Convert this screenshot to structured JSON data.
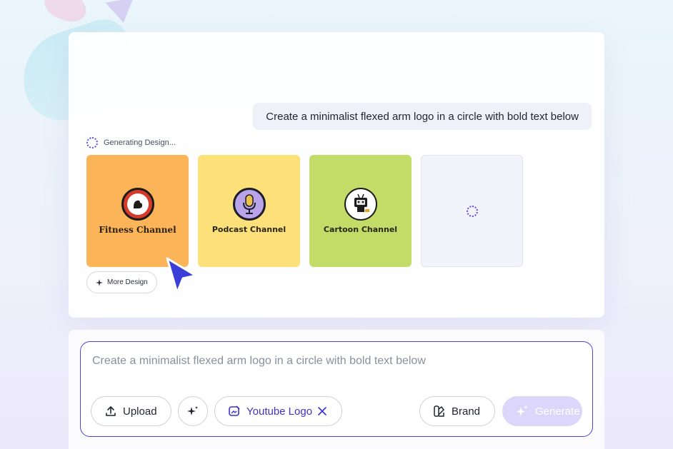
{
  "chat": {
    "prompt_text": "Create a minimalist flexed arm logo in a circle with bold text below",
    "status_text": "Generating Design...",
    "cards": [
      {
        "title": "Fitness Channel",
        "icon": "flexed-arm-icon"
      },
      {
        "title": "Podcast Channel",
        "icon": "microphone-icon"
      },
      {
        "title": "Cartoon Channel",
        "icon": "robot-icon"
      }
    ],
    "more_design_label": "More Design"
  },
  "composer": {
    "placeholder": "Create a minimalist flexed arm logo in a circle with bold text below",
    "upload_label": "Upload",
    "tag_label": "Youtube Logo",
    "brand_label": "Brand",
    "generate_label": "Generate"
  },
  "colors": {
    "accent": "#4c45d6",
    "card_fitness": "#fbb457",
    "card_podcast": "#fde07a",
    "card_cartoon": "#c3dc67",
    "generate_disabled": "#ddd6fb"
  }
}
